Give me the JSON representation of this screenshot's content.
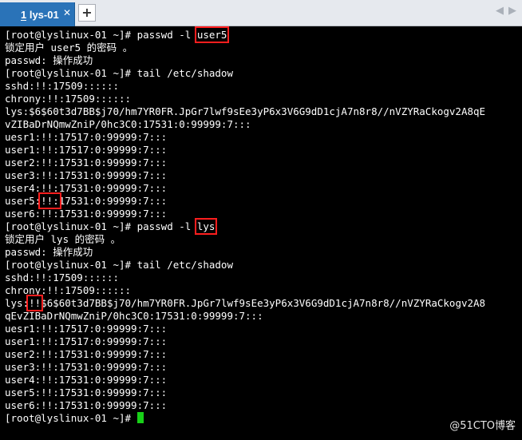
{
  "tabs": [
    {
      "label": "1 lys-01",
      "close": "✕"
    }
  ],
  "new_tab_label": "+",
  "nav": {
    "left": "◀",
    "right": "▶"
  },
  "terminal": {
    "lines": [
      {
        "text": "[root@lyslinux-01 ~]# passwd -l ",
        "hl": "user5"
      },
      {
        "text": "锁定用户 user5 的密码 。"
      },
      {
        "text": "passwd: 操作成功"
      },
      {
        "text": "[root@lyslinux-01 ~]# tail /etc/shadow"
      },
      {
        "text": "sshd:!!:17509::::::"
      },
      {
        "text": "chrony:!!:17509::::::"
      },
      {
        "text": "lys:$6$60t3d7BB$j70/hm7YR0FR.JpGr7lwf9sEe3yP6x3V6G9dD1cjA7n8r8//nVZYRaCkogv2A8qE"
      },
      {
        "text": "vZIBaDrNQmwZniP/0hc3C0:17531:0:99999:7:::"
      },
      {
        "text": "uesr1:!!:17517:0:99999:7:::"
      },
      {
        "text": "user1:!!:17517:0:99999:7:::"
      },
      {
        "text": "user2:!!:17531:0:99999:7:::"
      },
      {
        "text": "user3:!!:17531:0:99999:7:::"
      },
      {
        "text": "user4:!!:17531:0:99999:7:::"
      },
      {
        "text": "user5:",
        "hl": "!!:",
        "tail": "17531:0:99999:7:::"
      },
      {
        "text": "user6:!!:17531:0:99999:7:::"
      },
      {
        "text": "[root@lyslinux-01 ~]# passwd -l ",
        "hl": "lys"
      },
      {
        "text": "锁定用户 lys 的密码 。"
      },
      {
        "text": "passwd: 操作成功"
      },
      {
        "text": "[root@lyslinux-01 ~]# tail /etc/shadow"
      },
      {
        "text": "sshd:!!:17509::::::"
      },
      {
        "text": "chrony:!!:17509::::::"
      },
      {
        "text": "lys:",
        "hl": "!!",
        "tail": "$6$60t3d7BB$j70/hm7YR0FR.JpGr7lwf9sEe3yP6x3V6G9dD1cjA7n8r8//nVZYRaCkogv2A8"
      },
      {
        "text": "qEvZIBaDrNQmwZniP/0hc3C0:17531:0:99999:7:::"
      },
      {
        "text": "uesr1:!!:17517:0:99999:7:::"
      },
      {
        "text": "user1:!!:17517:0:99999:7:::"
      },
      {
        "text": "user2:!!:17531:0:99999:7:::"
      },
      {
        "text": "user3:!!:17531:0:99999:7:::"
      },
      {
        "text": "user4:!!:17531:0:99999:7:::"
      },
      {
        "text": "user5:!!:17531:0:99999:7:::"
      },
      {
        "text": "user6:!!:17531:0:99999:7:::"
      },
      {
        "text": "[root@lyslinux-01 ~]# ",
        "cursor": true
      }
    ]
  },
  "watermark": "@51CTO博客",
  "colors": {
    "tab_active": "#2a73b8",
    "highlight": "#ff1e1e",
    "cursor": "#18d018"
  }
}
